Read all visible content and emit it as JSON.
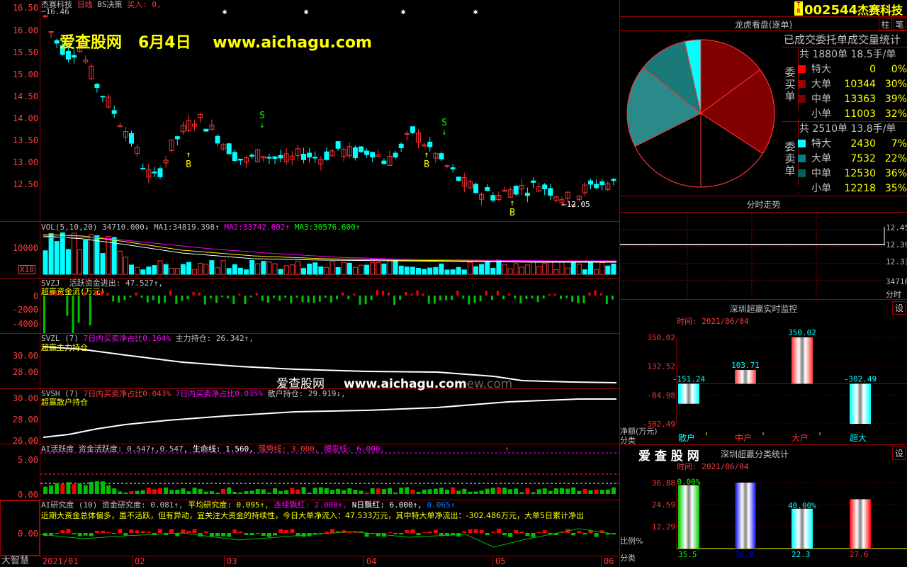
{
  "header": {
    "stock_name": "杰赛科技",
    "period": "日线",
    "strategy": "BS决策",
    "buy_label": "买入: 0,",
    "last_high": "16.46"
  },
  "price_axis": [
    "16.50",
    "16.00",
    "15.50",
    "15.00",
    "14.50",
    "14.00",
    "13.50",
    "13.00",
    "12.50"
  ],
  "watermark1": {
    "site": "爱查股网",
    "date": "6月4日",
    "url": "www.aichagu.com"
  },
  "watermark2": {
    "site": "爱查股网",
    "url": "www.aichagu.com",
    "extra": "ew.com"
  },
  "signals": {
    "buy": "B",
    "sell": "S",
    "low_label": "12.05"
  },
  "vol": {
    "title": "VOL(5,10,20)",
    "v": "34710.000↓",
    "ma1_label": "MA1:",
    "ma1": "34819.398↑",
    "ma2_label": "MA2:",
    "ma2": "33742.602↑",
    "ma3_label": "MA3:",
    "ma3": "30576.600↑",
    "axis": [
      "10000"
    ],
    "unit": "X10"
  },
  "svzj": {
    "title": "SVZJ",
    "desc": "活跃资金进出: 47.527↑,",
    "sub": "超赢资金流(万元)",
    "axis": [
      "0",
      "-2000",
      "-4000"
    ]
  },
  "svzl": {
    "title": "SVZL (7)",
    "desc1": "7日内买卖净占比0.164%",
    "desc2": "主力持仓: 26.342↑,",
    "sub": "超赢主力持仓",
    "axis": [
      "30.00",
      "28.00"
    ]
  },
  "svsh": {
    "title": "SVSH (7)",
    "desc1": "7日内买卖净占比0.043%",
    "desc2": "7日内买卖净占比0.035%",
    "desc3": "散户持仓: 29.919↓,",
    "sub": "超赢散户持仓",
    "axis": [
      "30.00",
      "28.00",
      "26.00"
    ]
  },
  "ai": {
    "title": "AI活跃度",
    "d1": "资金活跃度: 0.547↑,0.547,",
    "d2": "生命线: 1.560,",
    "d3": "强势线: 3.000,",
    "d4": "爆发线: 6.000,",
    "axis": [
      "5.00",
      "0.00"
    ]
  },
  "air": {
    "title": "AI研究度 (10)",
    "d1": "资金研究度: 0.081↑,",
    "d2": "平均研究度: 0.095↑,",
    "d3": "连续飘红: 2.000↑,",
    "d4": "N日飘红: 6.000↑,",
    "d5": "0.065↑",
    "comment": "近期大资金总体偏多，虽不活跃，但有异动，宜关注大资金的持续性，今日大单净流入：47.533万元，其中特大单净流出：-302.486万元，大单5日累计净出",
    "axis": [
      "0.00"
    ],
    "left_label": "大智慧"
  },
  "xaxis": [
    "2021/01",
    "02",
    "03",
    "04",
    "05",
    "06"
  ],
  "code_box": {
    "badge": "T R",
    "code": "002544",
    "name": "杰赛科技",
    "btn1": "柱",
    "btn2": "笔"
  },
  "pie_panel": {
    "title": "龙虎看盘(逐单)",
    "subtitle": "已成交委托单成交量统计",
    "buy": {
      "total": "共 1880单 18.5手/单",
      "side": "委买单",
      "rows": [
        {
          "label": "特大",
          "num": "0",
          "pct": "0%",
          "color": "#ff0000"
        },
        {
          "label": "大单",
          "num": "10344",
          "pct": "30%",
          "color": "#a00000"
        },
        {
          "label": "中单",
          "num": "13363",
          "pct": "39%",
          "color": "#800000"
        },
        {
          "label": "小单",
          "num": "11003",
          "pct": "32%",
          "color": "#000000"
        }
      ]
    },
    "sell": {
      "total": "共 2510单 13.8手/单",
      "side": "委卖单",
      "rows": [
        {
          "label": "特大",
          "num": "2430",
          "pct": "7%",
          "color": "#00ffff"
        },
        {
          "label": "大单",
          "num": "7532",
          "pct": "22%",
          "color": "#008080"
        },
        {
          "label": "中单",
          "num": "12530",
          "pct": "36%",
          "color": "#006060"
        },
        {
          "label": "小单",
          "num": "12218",
          "pct": "35%",
          "color": "#000000"
        }
      ]
    }
  },
  "fenshi": {
    "title": "分时走势",
    "axis": [
      "12.45",
      "12.39",
      "12.33"
    ],
    "vol": "34710",
    "unit": "分时"
  },
  "monitor1": {
    "title": "深圳超赢实时监控",
    "btn": "设",
    "time": "时间: 2021/06/04",
    "axis": [
      "350.02",
      "132.52",
      "-84.98",
      "-302.49"
    ],
    "y_label": "净额(万元)",
    "x_label": "分类",
    "bars": [
      {
        "label": "散户",
        "value": "-151.24"
      },
      {
        "label": "中户",
        "value": "103.71"
      },
      {
        "label": "大户",
        "value": "350.02"
      },
      {
        "label": "超大",
        "value": "-302.49"
      }
    ]
  },
  "monitor2": {
    "title": "深圳超赢分类统计",
    "logo": "爱 查 股 网",
    "btn": "设",
    "time": "时间: 2021/06/04",
    "axis": [
      "36.88",
      "24.59",
      "12.29"
    ],
    "y_label": "比例%",
    "x_label": "分类",
    "bars": [
      {
        "label": "散户",
        "value": "35.5",
        "pct": "0.00%"
      },
      {
        "label": "中户",
        "value": "36.9",
        "pct": ""
      },
      {
        "label": "大户",
        "value": "22.3",
        "pct": "40.00%"
      },
      {
        "label": "超大",
        "value": "27.6",
        "pct": ""
      }
    ]
  },
  "colors": {
    "up": "#ff3232",
    "down": "#00ffff",
    "grid": "#a00000",
    "axis_text": "#ff3b3b",
    "yellow": "#ffff00"
  }
}
